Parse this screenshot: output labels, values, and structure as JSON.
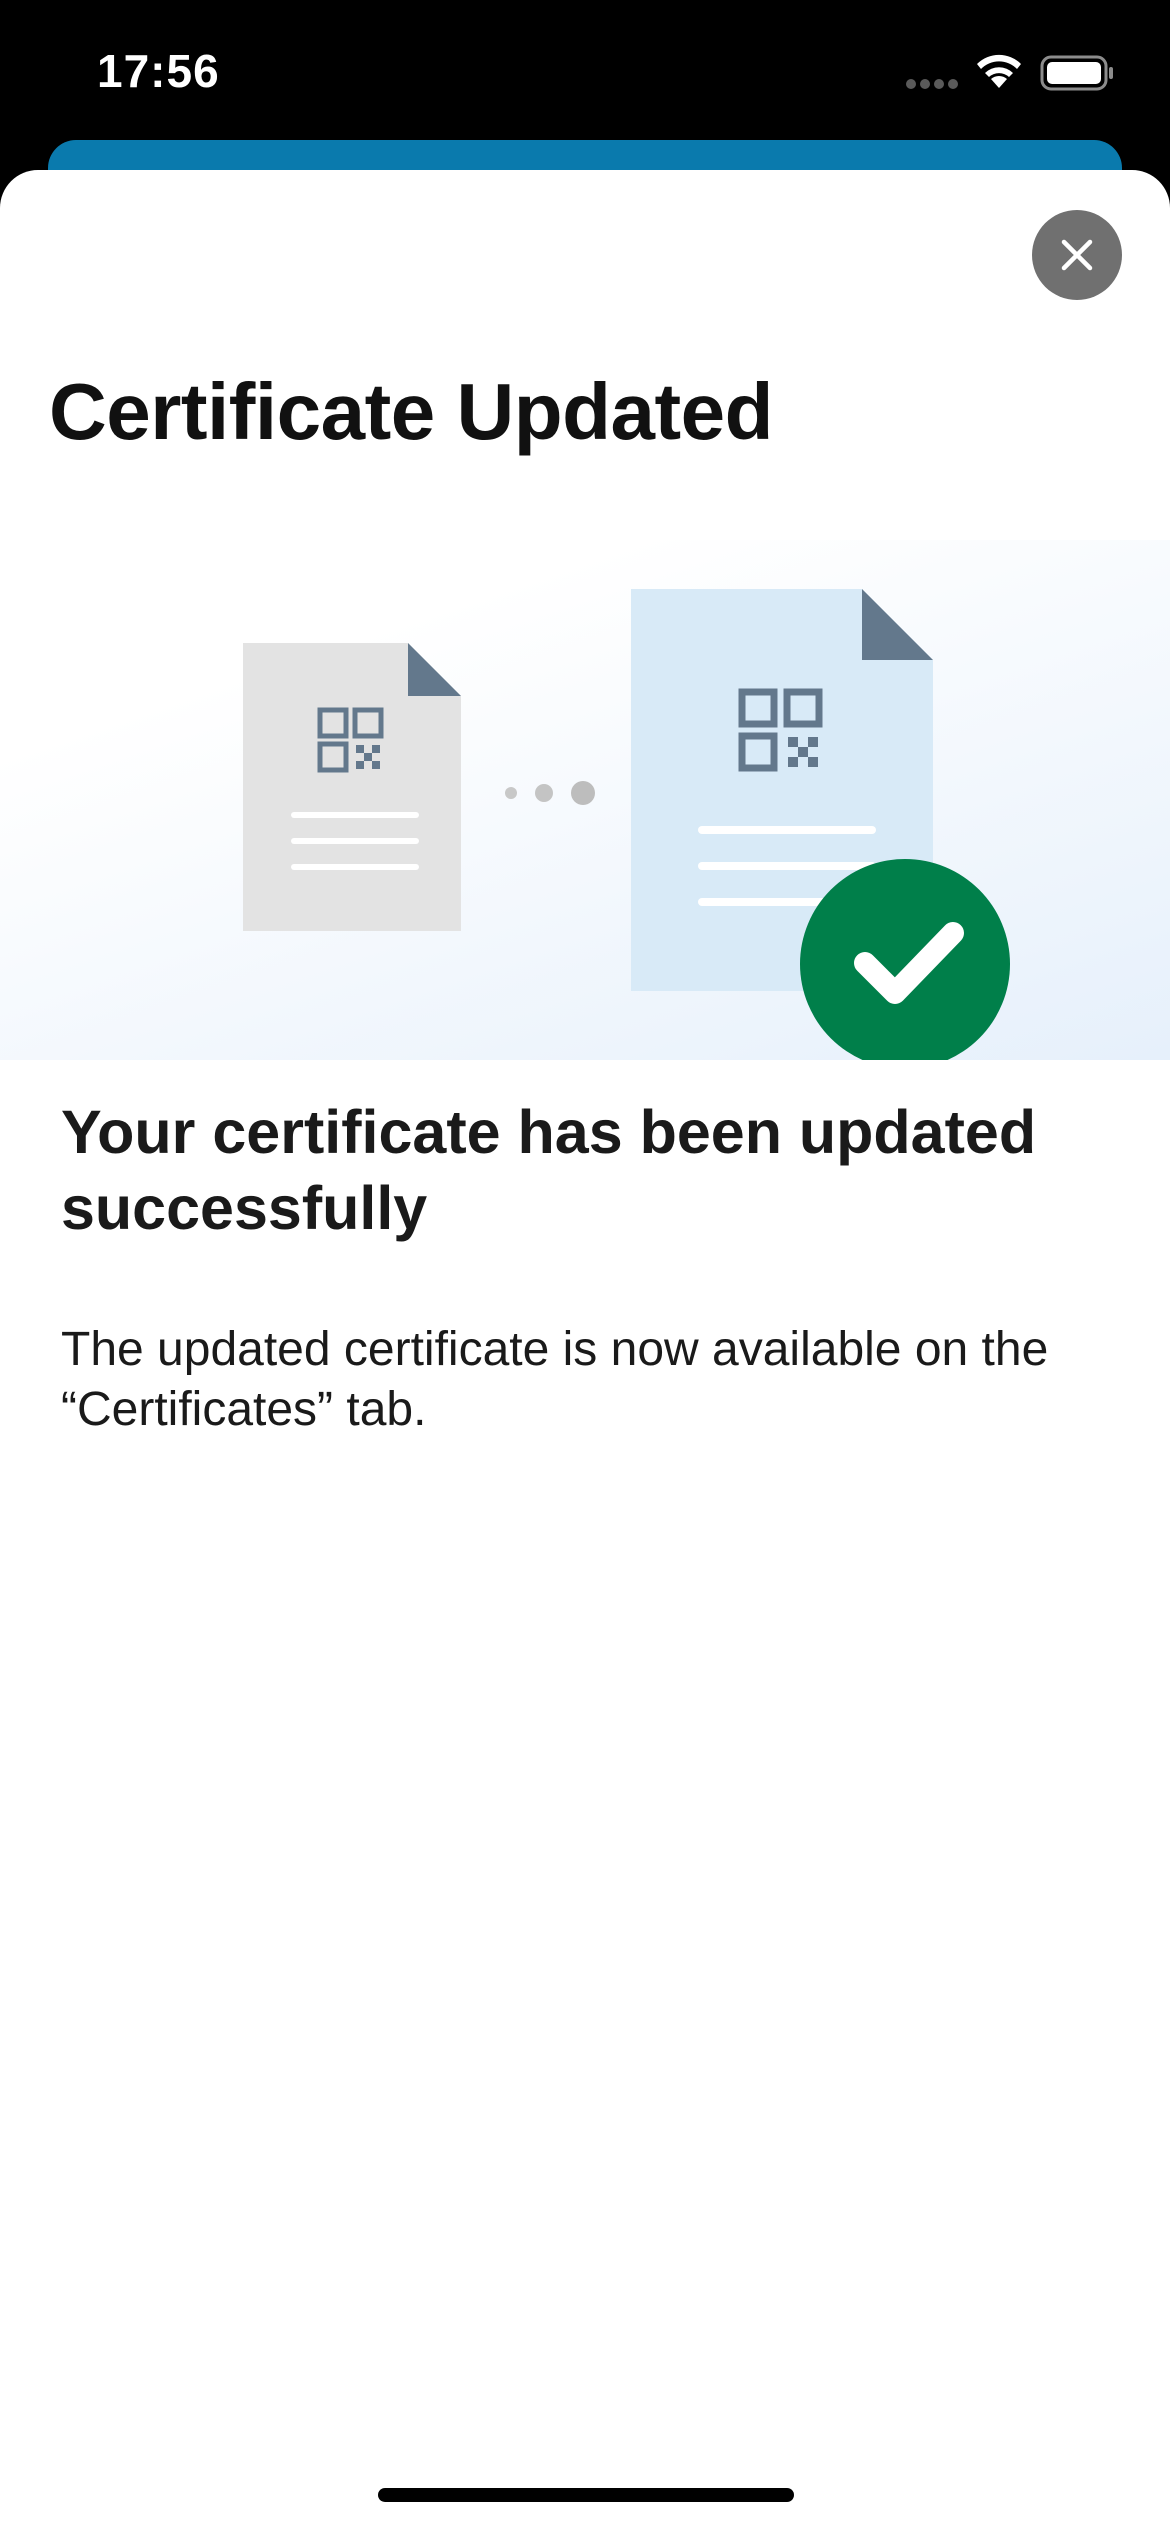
{
  "status_bar": {
    "time": "17:56"
  },
  "sheet": {
    "title": "Certificate Updated",
    "headline": "Your certificate has been updated successfully",
    "body": "The updated certificate is now available on the “Certificates” tab."
  },
  "icons": {
    "close": "close-icon",
    "illustration": "certificate-updated-illustration",
    "success": "checkmark-icon"
  },
  "colors": {
    "success_green": "#007f4a",
    "under_card_blue": "#0a7aad",
    "close_button_gray": "#707070",
    "new_document_blue": "#d8eaf7",
    "old_document_gray": "#e3e3e3",
    "document_ink": "#63788c"
  }
}
